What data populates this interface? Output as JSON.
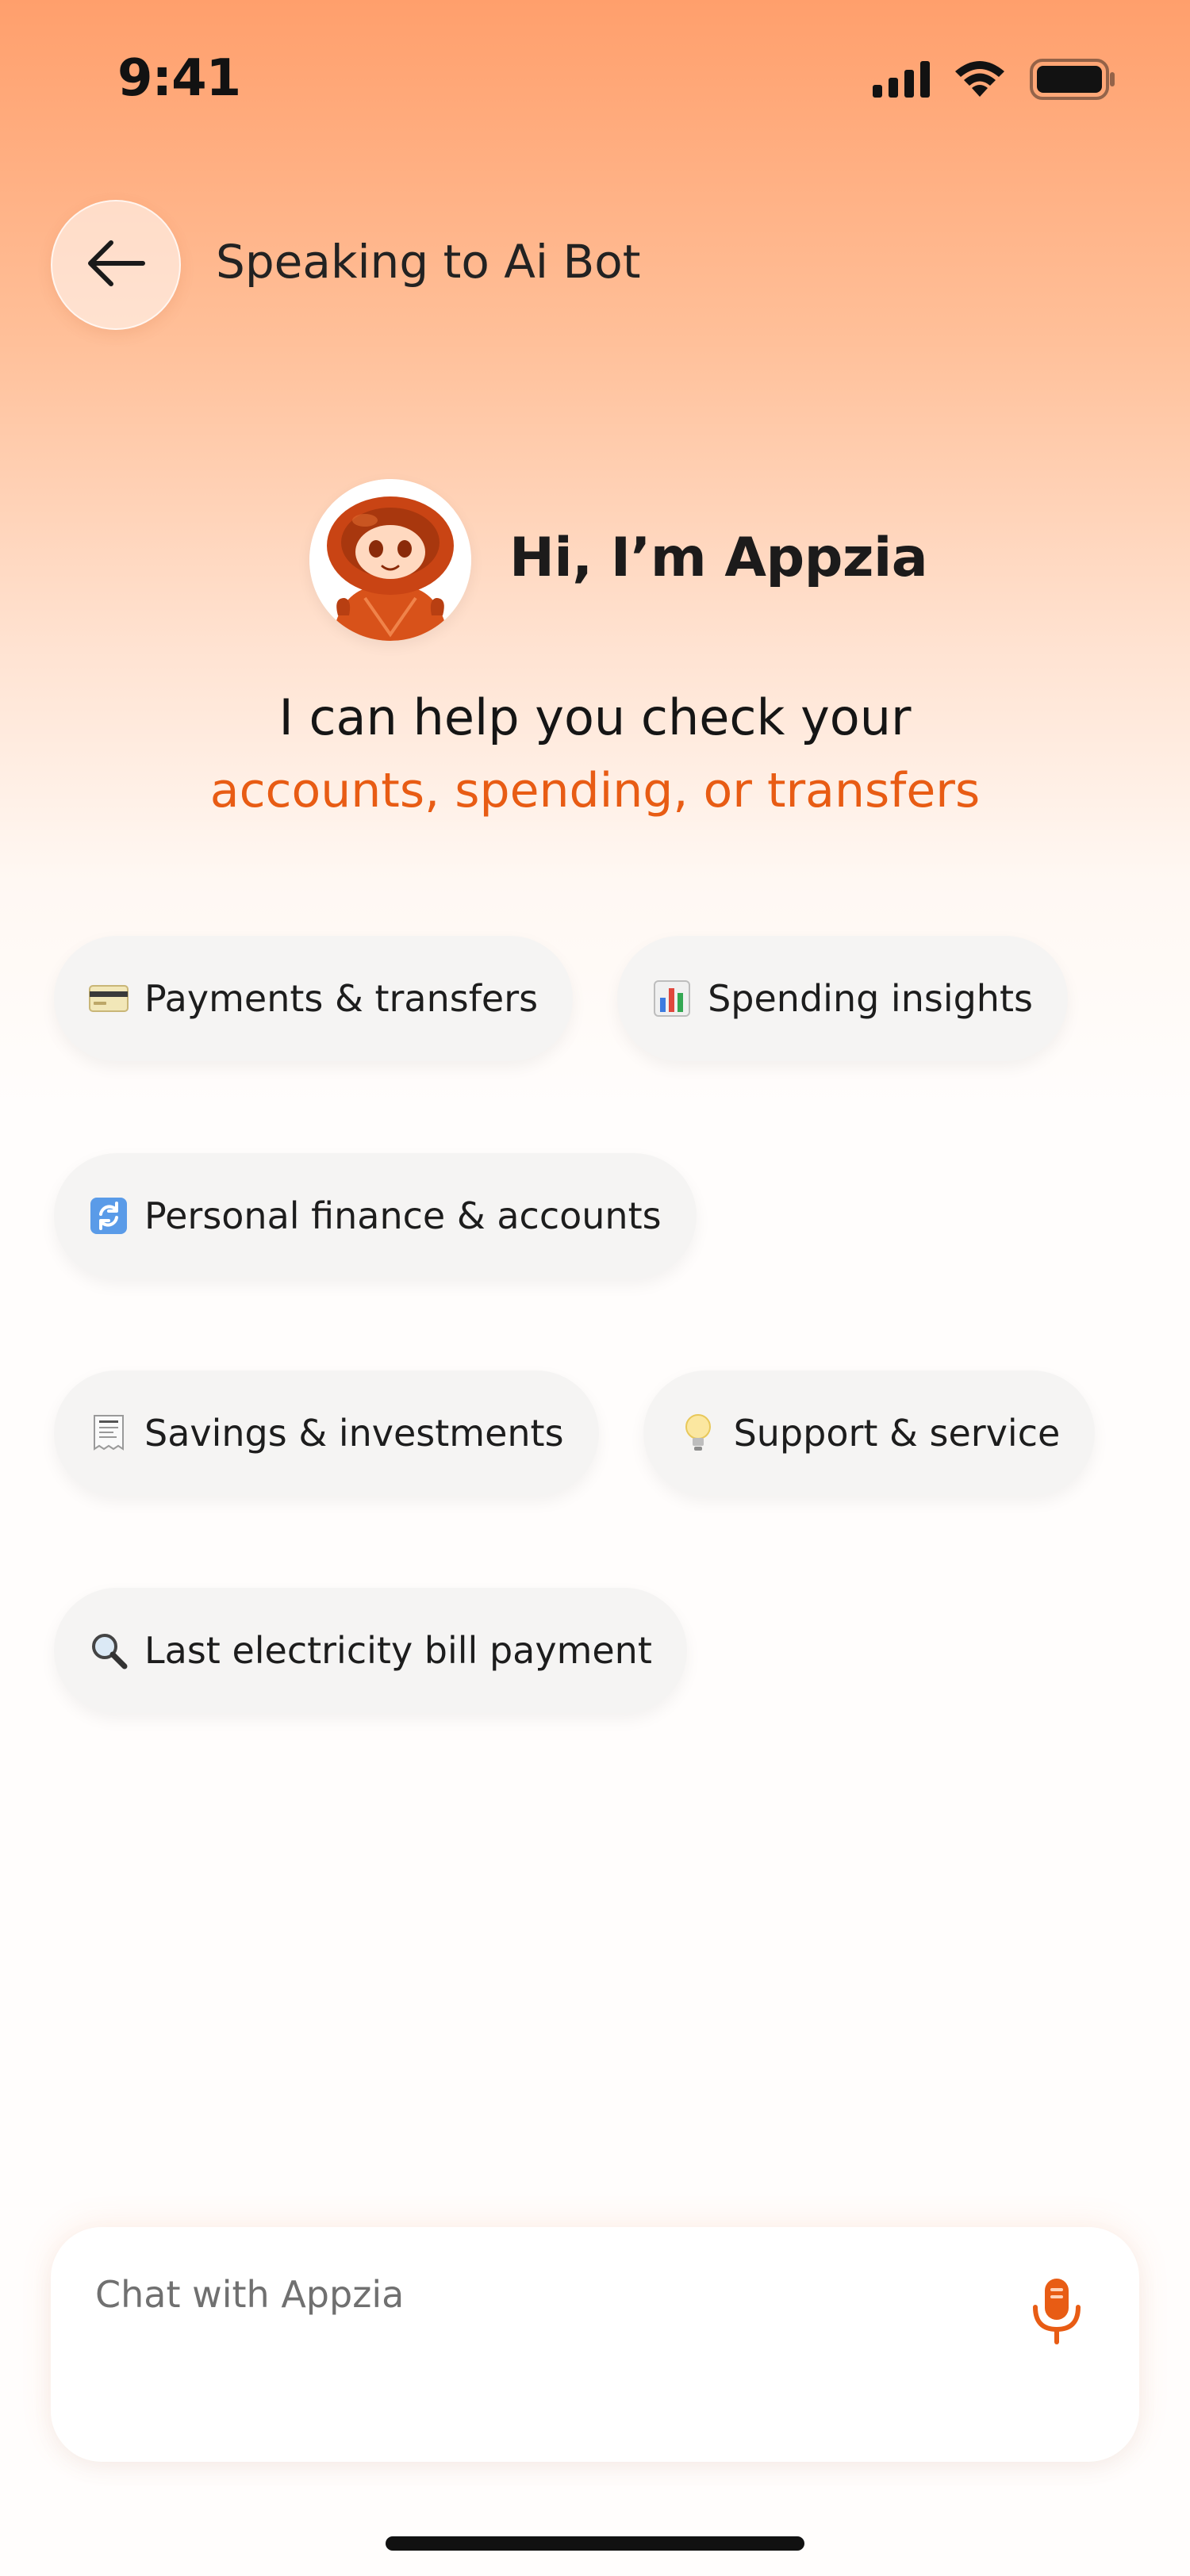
{
  "status_bar": {
    "time": "9:41"
  },
  "header": {
    "title": "Speaking to Ai Bot",
    "back_icon": "arrow-left-icon"
  },
  "bot": {
    "greeting": "Hi, I’m Appzia",
    "subtitle": "I can help you check your",
    "subtitle_accent": "accounts, spending, or transfers"
  },
  "chips": [
    {
      "label": "Payments & transfers",
      "icon": "credit-card-icon"
    },
    {
      "label": "Spending insights",
      "icon": "bar-chart-icon"
    },
    {
      "label": "Personal finance & accounts",
      "icon": "refresh-icon"
    },
    {
      "label": "Savings & investments",
      "icon": "receipt-icon"
    },
    {
      "label": "Support & service",
      "icon": "lightbulb-icon"
    },
    {
      "label": "Last electricity bill payment",
      "icon": "magnifier-icon"
    }
  ],
  "chat": {
    "placeholder": "Chat with Appzia",
    "mic_icon": "microphone-icon"
  },
  "colors": {
    "accent": "#e85c14",
    "header_gradient_top": "#ff9f6c",
    "background": "#fffdfc"
  }
}
